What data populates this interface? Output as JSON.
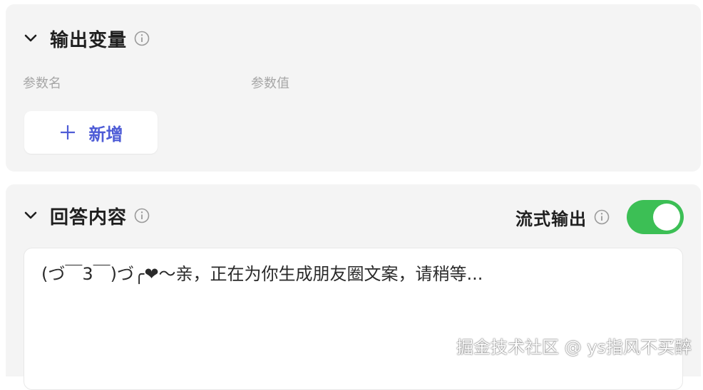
{
  "output_section": {
    "title": "输出变量",
    "columns": {
      "name": "参数名",
      "value": "参数值"
    },
    "add_button_label": "新增"
  },
  "answer_section": {
    "title": "回答内容",
    "stream_label": "流式输出",
    "stream_enabled": true,
    "content": "(づ￣3￣)づ╭❤～亲，正在为你生成朋友圈文案，请稍等..."
  },
  "watermark": "掘金技术社区 @ ys指风不买醉",
  "colors": {
    "panel_bg": "#f4f4f4",
    "accent_blue": "#4e5cd6",
    "toggle_on": "#3cbf55",
    "label_grey": "#a6a6a6"
  },
  "icons": {
    "collapse": "chevron-down-icon",
    "info": "info-icon",
    "add": "plus-icon"
  }
}
